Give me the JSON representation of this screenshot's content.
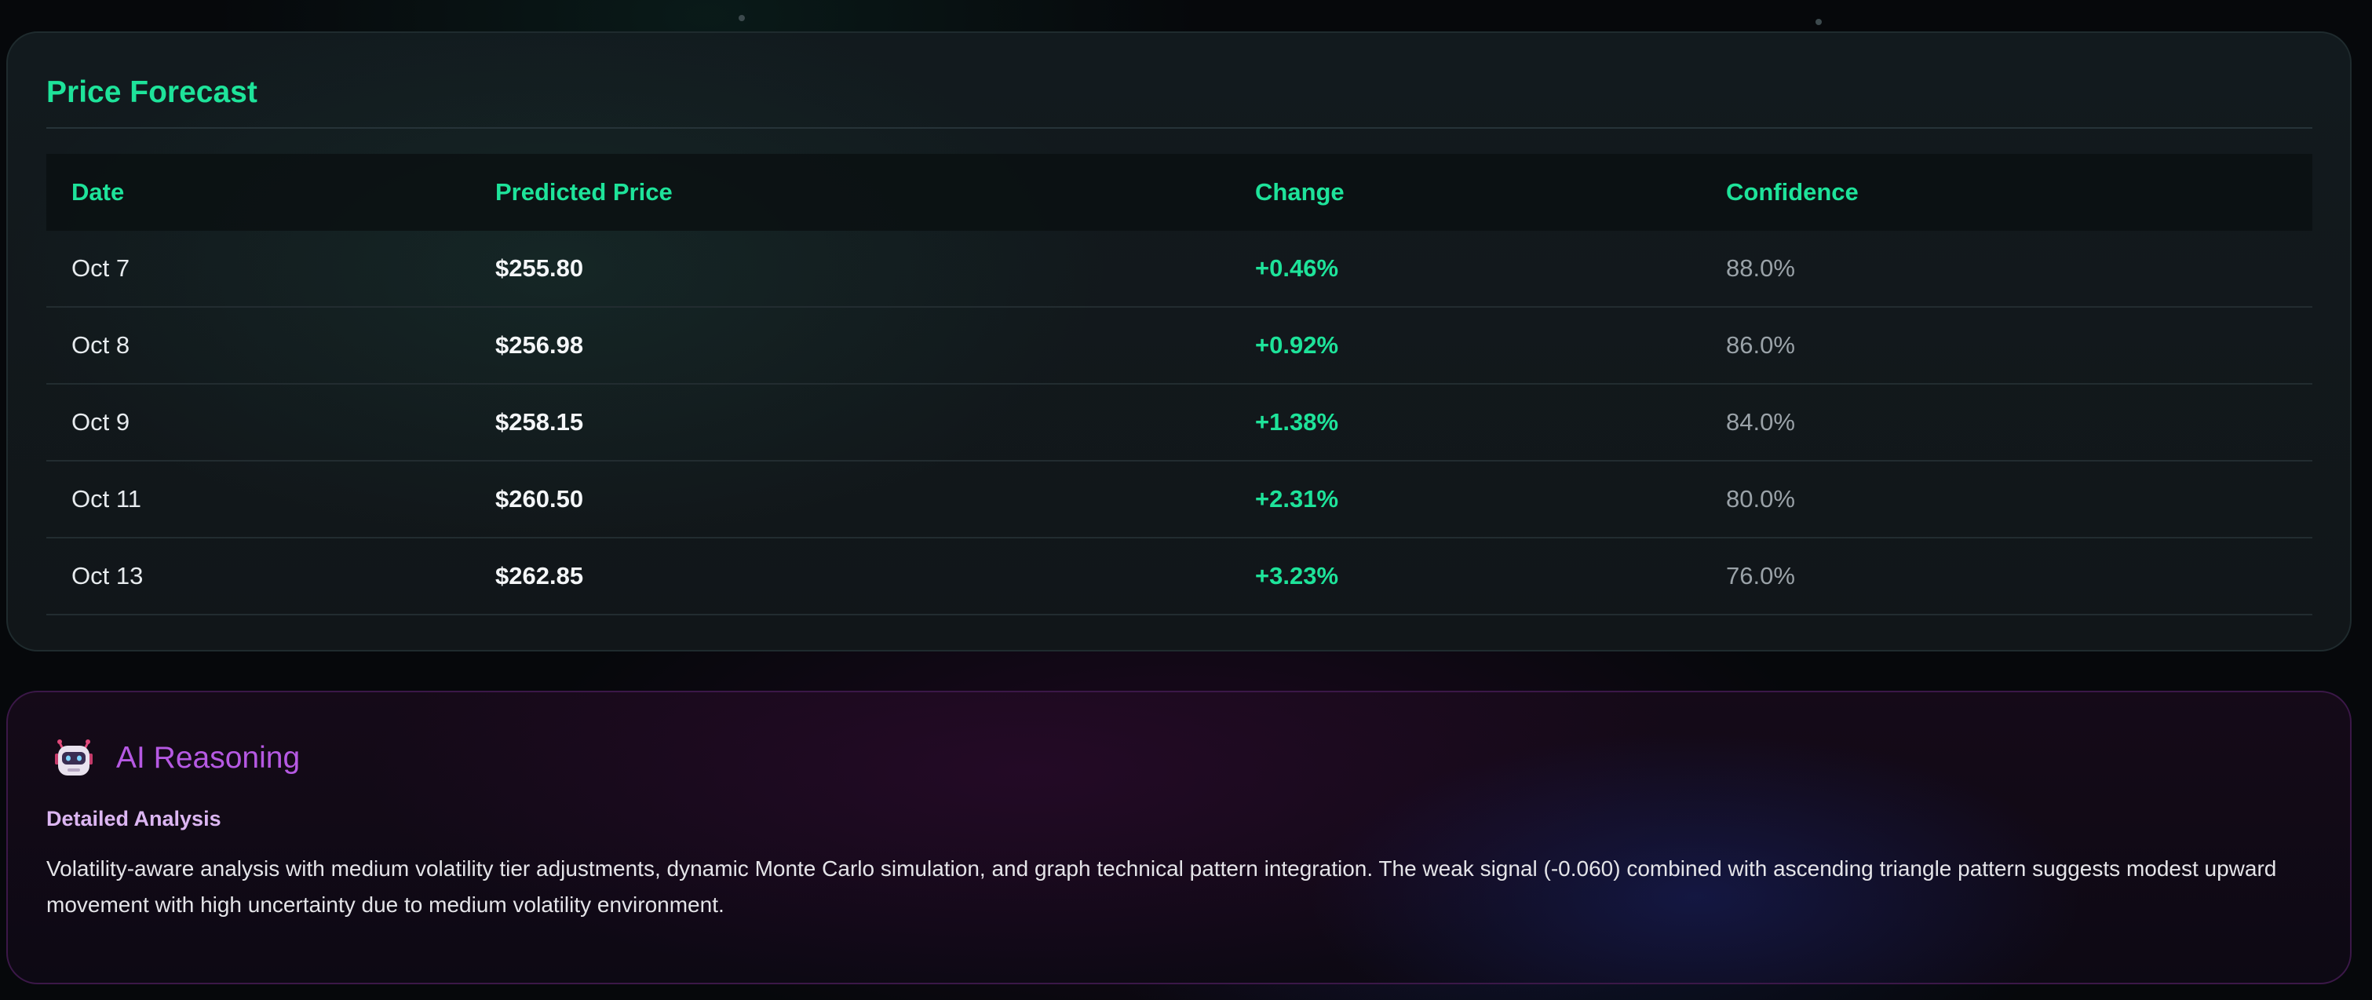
{
  "forecast": {
    "title": "Price Forecast",
    "columns": {
      "date": "Date",
      "price": "Predicted Price",
      "change": "Change",
      "confidence": "Confidence"
    },
    "rows": [
      {
        "date": "Oct 7",
        "price": "$255.80",
        "change": "+0.46%",
        "confidence": "88.0%"
      },
      {
        "date": "Oct 8",
        "price": "$256.98",
        "change": "+0.92%",
        "confidence": "86.0%"
      },
      {
        "date": "Oct 9",
        "price": "$258.15",
        "change": "+1.38%",
        "confidence": "84.0%"
      },
      {
        "date": "Oct 11",
        "price": "$260.50",
        "change": "+2.31%",
        "confidence": "80.0%"
      },
      {
        "date": "Oct 13",
        "price": "$262.85",
        "change": "+3.23%",
        "confidence": "76.0%"
      }
    ]
  },
  "reasoning": {
    "icon": "robot-icon",
    "title": "AI Reasoning",
    "section_heading": "Detailed Analysis",
    "text": "Volatility-aware analysis with medium volatility tier adjustments, dynamic Monte Carlo simulation, and graph technical pattern integration. The weak signal (-0.060) combined with ascending triangle pattern suggests modest upward movement with high uncertainty due to medium volatility environment."
  },
  "colors": {
    "accent_green": "#1ee39a",
    "accent_purple": "#b659e3",
    "background": "#06080b"
  }
}
